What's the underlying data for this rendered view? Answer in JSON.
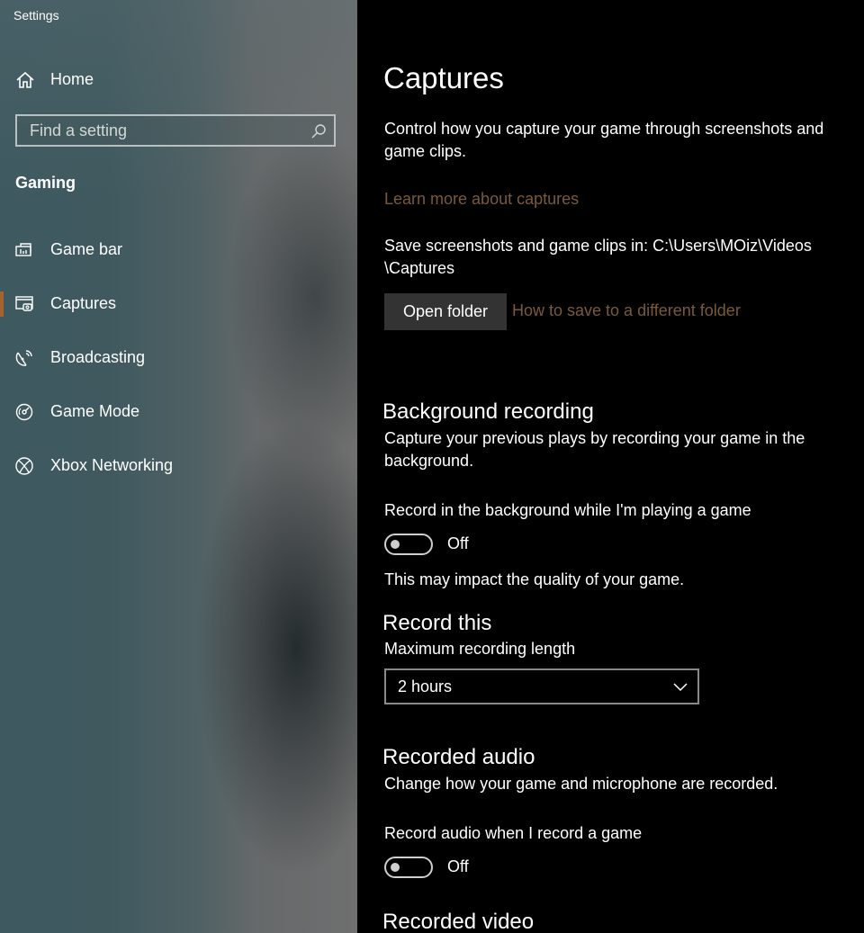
{
  "window": {
    "title": "Settings"
  },
  "sidebar": {
    "home_label": "Home",
    "search_placeholder": "Find a setting",
    "section_title": "Gaming",
    "items": [
      {
        "label": "Game bar",
        "icon": "game-bar-icon"
      },
      {
        "label": "Captures",
        "icon": "captures-icon",
        "active": true
      },
      {
        "label": "Broadcasting",
        "icon": "broadcasting-icon"
      },
      {
        "label": "Game Mode",
        "icon": "game-mode-icon"
      },
      {
        "label": "Xbox Networking",
        "icon": "xbox-icon"
      }
    ]
  },
  "main": {
    "title": "Captures",
    "description": "Control how you capture your game through screenshots and game clips.",
    "learn_more_link": "Learn more about captures",
    "save_location_text": "Save screenshots and game clips in: C:\\Users\\MOiz\\Videos\\Captures",
    "open_folder_button": "Open folder",
    "save_different_link": "How to save to a different folder",
    "background_recording": {
      "heading": "Background recording",
      "description": "Capture your previous plays by recording your game in the background.",
      "toggle_label": "Record in the background while I'm playing a game",
      "toggle_state": "Off",
      "note": "This may impact the quality of your game."
    },
    "record_this": {
      "heading": "Record this",
      "label": "Maximum recording length",
      "selected": "2 hours"
    },
    "recorded_audio": {
      "heading": "Recorded audio",
      "description": "Change how your game and microphone are recorded.",
      "toggle_label": "Record audio when I record a game",
      "toggle_state": "Off"
    },
    "recorded_video": {
      "heading": "Recorded video"
    }
  },
  "colors": {
    "accent": "#a6642c",
    "link": "#7a5a3a",
    "button_bg": "#333333"
  }
}
